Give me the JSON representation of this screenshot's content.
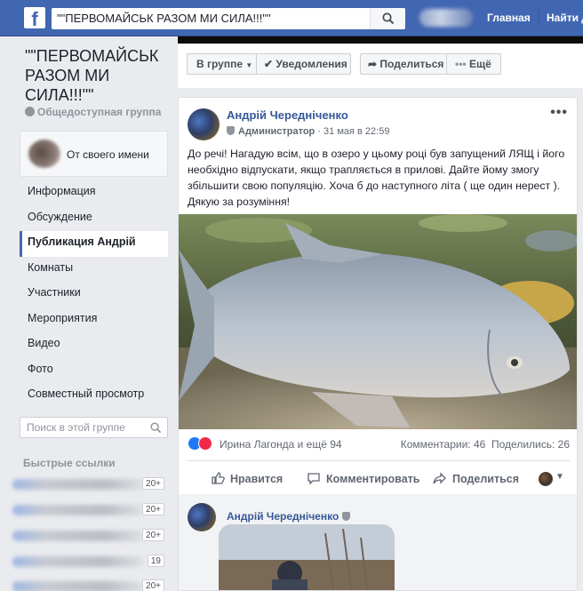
{
  "topbar": {
    "logo": "f",
    "search_value": "\"\"ПЕРВОМАЙСЬК РАЗОМ МИ СИЛА!!!\"\"",
    "links": [
      "Главная",
      "Найти д"
    ]
  },
  "group": {
    "title": "\"\"ПЕРВОМАЙСЬК РАЗОМ МИ СИЛА!!!\"\"",
    "type": "Общедоступная группа",
    "identity_label": "От своего имени"
  },
  "nav": {
    "items": [
      {
        "label": "Информация"
      },
      {
        "label": "Обсуждение"
      },
      {
        "label": "Публикация Андрій"
      },
      {
        "label": "Комнаты"
      },
      {
        "label": "Участники"
      },
      {
        "label": "Мероприятия"
      },
      {
        "label": "Видео"
      },
      {
        "label": "Фото"
      },
      {
        "label": "Совместный просмотр"
      }
    ],
    "active_index": 2
  },
  "group_search": {
    "placeholder": "Поиск в этой группе"
  },
  "quick_links": {
    "title": "Быстрые ссылки",
    "badges": [
      "20+",
      "20+",
      "20+",
      "19",
      "20+"
    ]
  },
  "actions_bar": {
    "in_group": "В группе",
    "notifications": "Уведомления",
    "share": "Поделиться",
    "more": "Ещё"
  },
  "post": {
    "author": "Андрій Чередніченко",
    "role": "Администратор",
    "date": "31 мая в 22:59",
    "text": "До речі! Нагадую всім, що в озеро у цьому році був запущений ЛЯЩ і його необхідно відпускати, якщо трапляється в прилові. Дайте йому змогу збільшити свою популяцію. Хоча б до наступного літа ( ще один нерест ). Дякую за розуміння!",
    "reactions_text": "Ирина Лагонда и ещё 94",
    "comments_text": "Комментарии: 46",
    "shares_text": "Поделились: 26",
    "like_label": "Нравится",
    "comment_label": "Комментировать",
    "share_label": "Поделиться"
  },
  "comment": {
    "author": "Андрій Чередніченко"
  },
  "colors": {
    "brand": "#4267b2",
    "link": "#365899",
    "like": "#2078f4",
    "love": "#f0284a"
  }
}
